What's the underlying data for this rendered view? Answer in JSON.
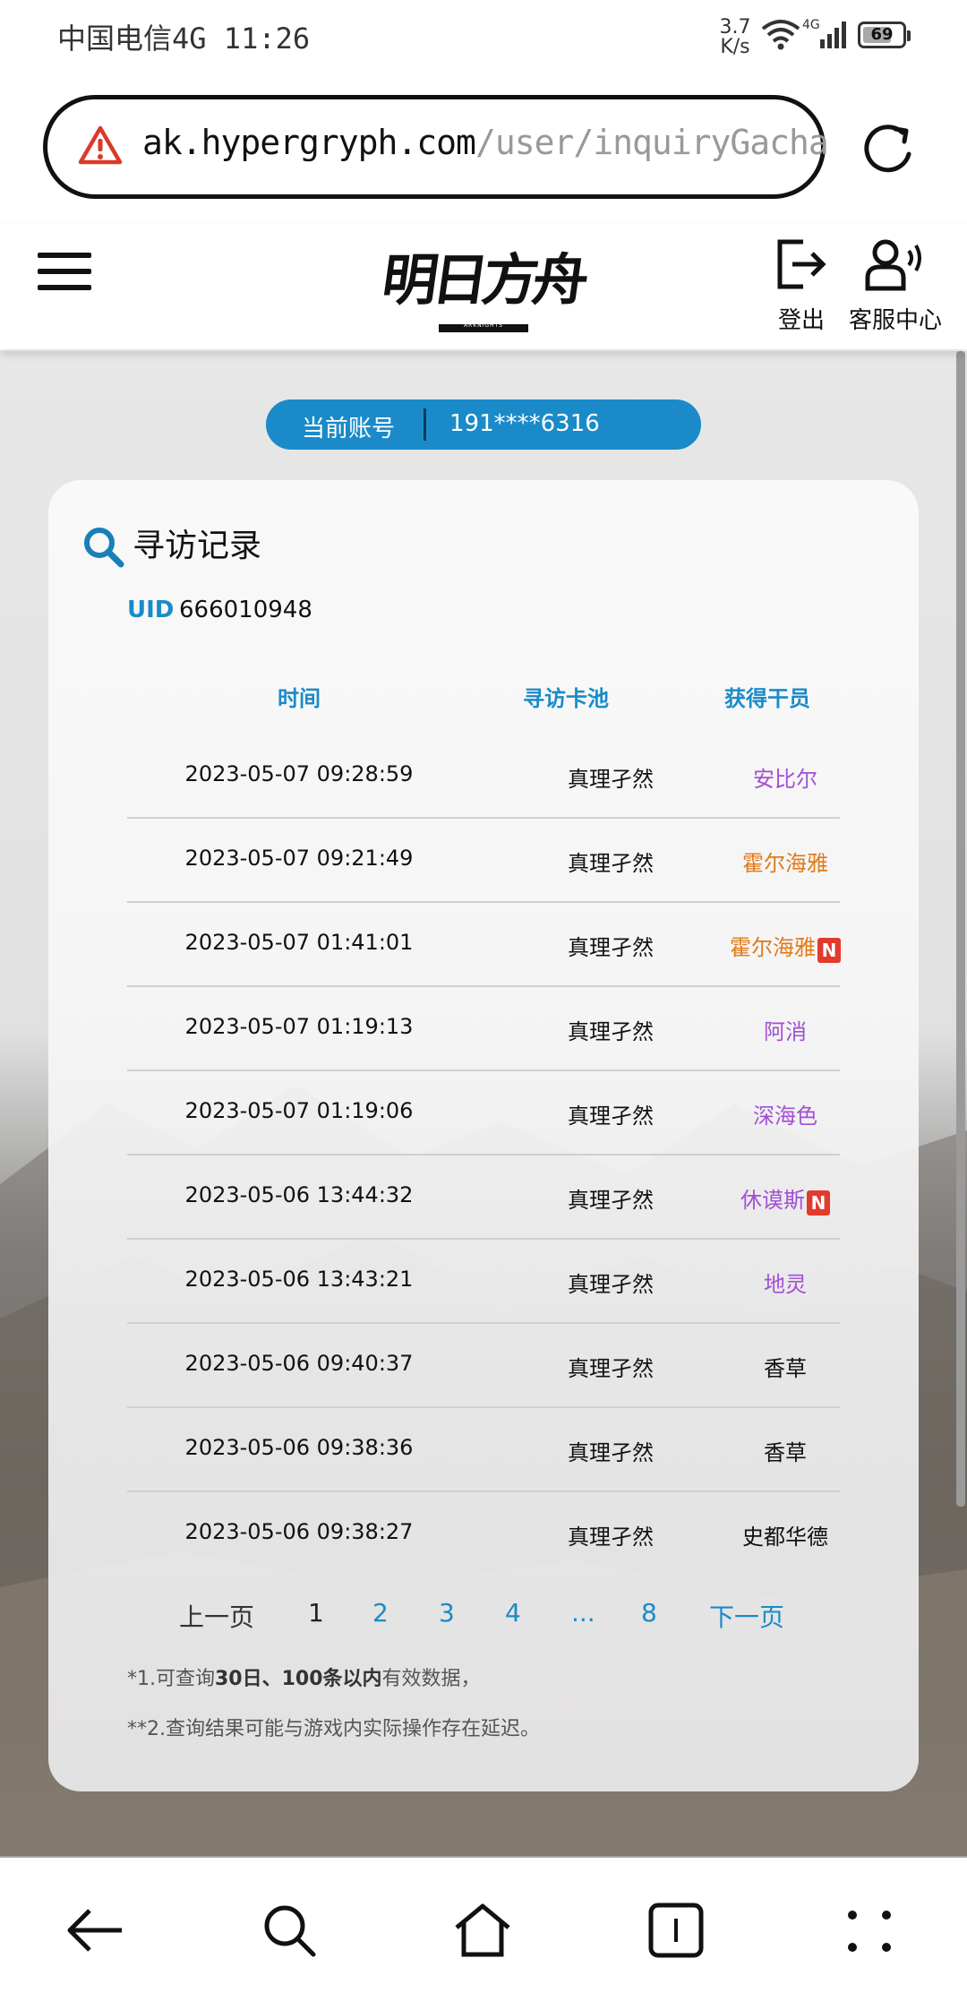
{
  "status_bar": {
    "carrier_time": "中国电信4G 11:26",
    "speed_value": "3.7",
    "speed_unit": "K/s",
    "network": "4G",
    "battery": "69"
  },
  "browser": {
    "url_host": "ak.hypergryph.com",
    "url_path": "/user/inquiryGacha"
  },
  "site_header": {
    "logo_text": "明日方舟",
    "logo_sub": "ARKNIGHTS",
    "logout_label": "登出",
    "service_label": "客服中心"
  },
  "account": {
    "label": "当前账号",
    "value": "191****6316"
  },
  "records": {
    "title": "寻访记录",
    "uid_label": "UID",
    "uid_value": "666010948",
    "columns": [
      "时间",
      "寻访卡池",
      "获得干员"
    ],
    "rows": [
      {
        "time": "2023-05-07 09:28:59",
        "pool": "真理孑然",
        "operator": "安比尔",
        "rarity_color": "#a34fd6",
        "is_new": false
      },
      {
        "time": "2023-05-07 09:21:49",
        "pool": "真理孑然",
        "operator": "霍尔海雅",
        "rarity_color": "#e07a1a",
        "is_new": false
      },
      {
        "time": "2023-05-07 01:41:01",
        "pool": "真理孑然",
        "operator": "霍尔海雅",
        "rarity_color": "#e07a1a",
        "is_new": true
      },
      {
        "time": "2023-05-07 01:19:13",
        "pool": "真理孑然",
        "operator": "阿消",
        "rarity_color": "#a34fd6",
        "is_new": false
      },
      {
        "time": "2023-05-07 01:19:06",
        "pool": "真理孑然",
        "operator": "深海色",
        "rarity_color": "#a34fd6",
        "is_new": false
      },
      {
        "time": "2023-05-06 13:44:32",
        "pool": "真理孑然",
        "operator": "休谟斯",
        "rarity_color": "#a34fd6",
        "is_new": true
      },
      {
        "time": "2023-05-06 13:43:21",
        "pool": "真理孑然",
        "operator": "地灵",
        "rarity_color": "#a34fd6",
        "is_new": false
      },
      {
        "time": "2023-05-06 09:40:37",
        "pool": "真理孑然",
        "operator": "香草",
        "rarity_color": "#111111",
        "is_new": false
      },
      {
        "time": "2023-05-06 09:38:36",
        "pool": "真理孑然",
        "operator": "香草",
        "rarity_color": "#111111",
        "is_new": false
      },
      {
        "time": "2023-05-06 09:38:27",
        "pool": "真理孑然",
        "operator": "史都华德",
        "rarity_color": "#111111",
        "is_new": false
      }
    ],
    "new_badge": "N"
  },
  "pagination": {
    "prev": "上一页",
    "pages": [
      "1",
      "2",
      "3",
      "4",
      "...",
      "8"
    ],
    "current": "1",
    "next": "下一页"
  },
  "notes": {
    "n1_pre": "*1.可查询",
    "n1_bold": "30日、100条以内",
    "n1_post": "有效数据，",
    "n2": "**2.查询结果可能与游戏内实际操作存在延迟。"
  },
  "colors": {
    "accent": "#1a8bc8",
    "six_star": "#e07a1a",
    "five_star": "#a34fd6",
    "new_badge": "#e23b2e"
  }
}
